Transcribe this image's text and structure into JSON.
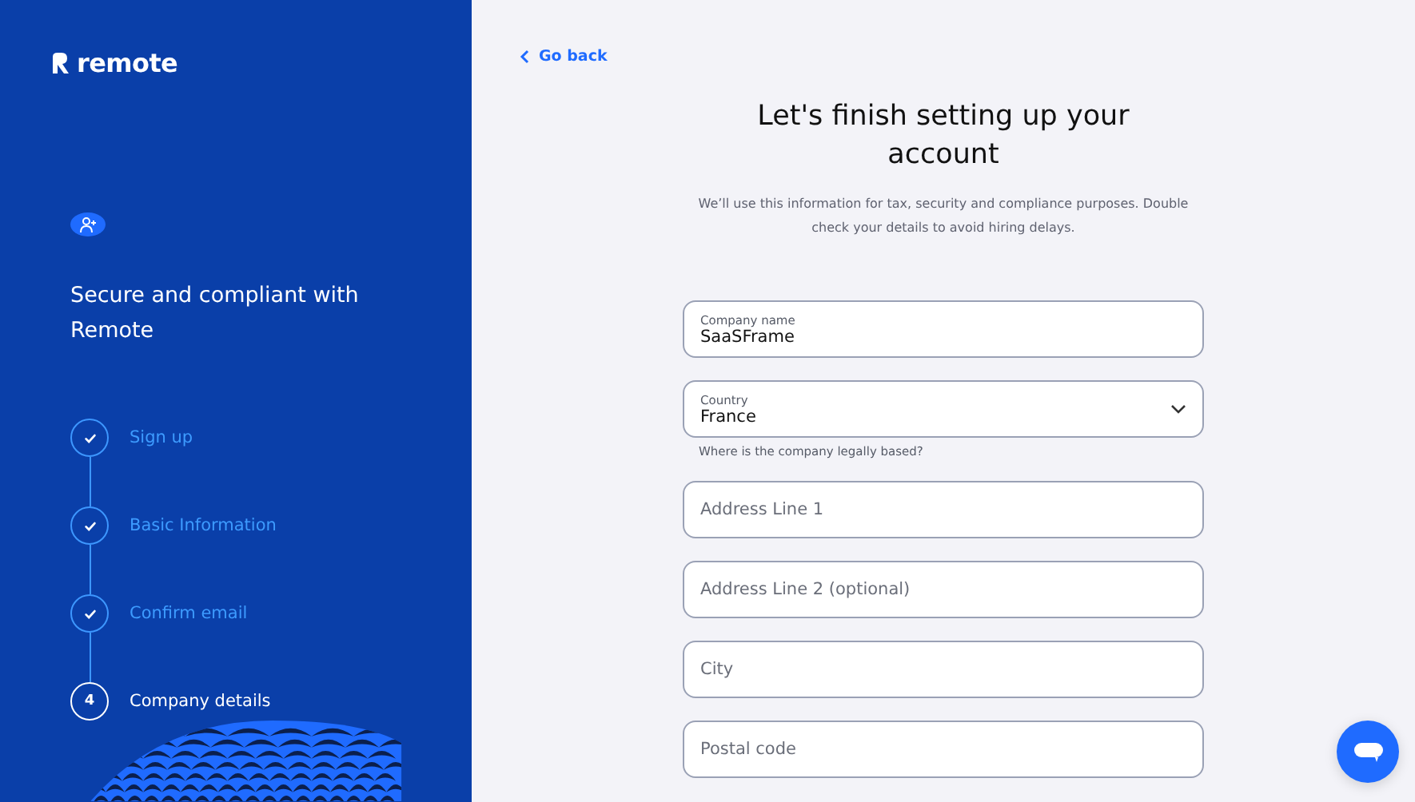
{
  "sidebar": {
    "logo": "remote",
    "headline": "Secure and compliant with Remote",
    "steps": [
      {
        "label": "Sign up",
        "completed": true
      },
      {
        "label": "Basic Information",
        "completed": true
      },
      {
        "label": "Confirm email",
        "completed": true
      },
      {
        "label": "Company details",
        "completed": false,
        "number": "4"
      }
    ]
  },
  "main": {
    "back_link": "Go back",
    "title": "Let's finish setting up your account",
    "subtitle": "We’ll use this information for tax, security and compliance purposes. Double check your details to avoid hiring delays.",
    "fields": [
      {
        "kind": "text",
        "label": "Company name",
        "value": "SaaSFrame"
      },
      {
        "kind": "select",
        "label": "Country",
        "value": "France",
        "hint": "Where is the company legally based?"
      },
      {
        "kind": "text",
        "placeholder": "Address Line 1"
      },
      {
        "kind": "text",
        "placeholder": "Address Line 2 (optional)"
      },
      {
        "kind": "text",
        "placeholder": "City"
      },
      {
        "kind": "text",
        "placeholder": "Postal code"
      }
    ]
  }
}
